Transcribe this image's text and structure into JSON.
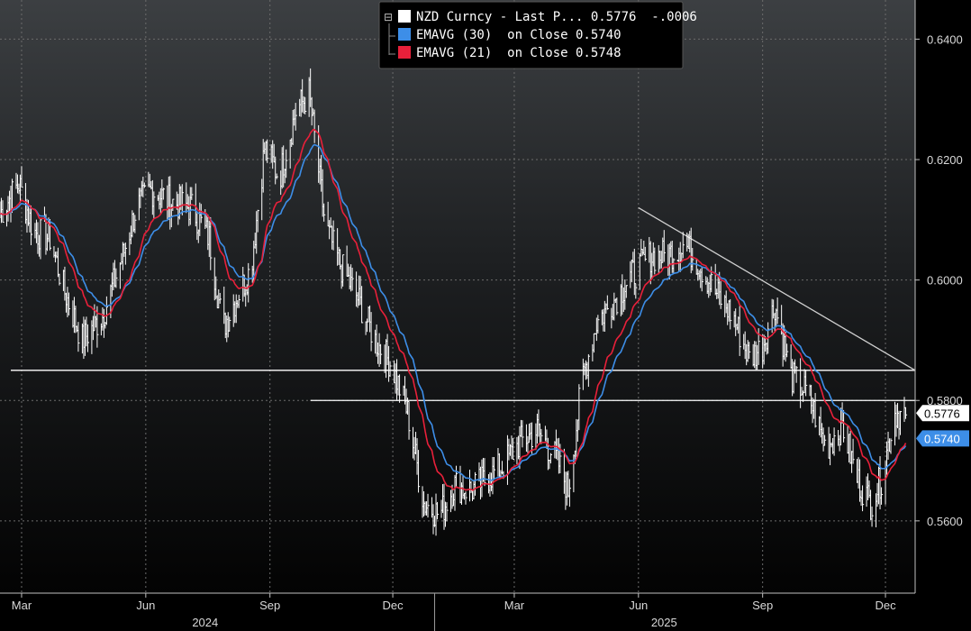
{
  "chart_data": {
    "type": "line",
    "title": "",
    "background": "#000000",
    "ylim": [
      0.548,
      0.6465
    ],
    "y_ticks": [
      "0.6400",
      "0.6200",
      "0.6000",
      "0.5800",
      "0.5600"
    ],
    "y_tick_values": [
      0.64,
      0.62,
      0.6,
      0.58,
      0.56
    ],
    "x_tick_labels": [
      "Mar",
      "Jun",
      "Sep",
      "Dec",
      "Mar",
      "Jun",
      "Sep",
      "Dec"
    ],
    "x_tick_dates": [
      "2024-03-01",
      "2024-06-01",
      "2024-09-01",
      "2024-12-01",
      "2025-03-01",
      "2025-06-01",
      "2025-09-01",
      "2025-12-01"
    ],
    "x_year_labels": [
      {
        "label": "2024",
        "date": "2024-07-15"
      },
      {
        "label": "2025",
        "date": "2025-06-20"
      }
    ],
    "x_range": [
      "2024-02-14",
      "2025-12-23"
    ],
    "legend": {
      "collapse_glyph": "⊟",
      "entries": [
        {
          "label": "NZD Curncy - Last P... 0.5776  -.0006",
          "color": "#ffffff"
        },
        {
          "label": "EMAVG (30)  on Close 0.5740",
          "color": "#3d8ee8"
        },
        {
          "label": "EMAVG (21)  on Close 0.5748",
          "color": "#e8203a"
        }
      ]
    },
    "last_value_tags": [
      {
        "label": "0.5776",
        "value": 0.5776,
        "bg": "#ffffff",
        "fg": "#000000"
      },
      {
        "label": "0.5740",
        "value": 0.574,
        "bg": "#3d8ee8",
        "fg": "#ffffff"
      }
    ],
    "annotations": {
      "horizontal_lines": [
        {
          "y": 0.585,
          "from": "2024-02-22",
          "to": "2025-12-23"
        },
        {
          "y": 0.58,
          "from": "2024-10-01",
          "to": "2025-12-23"
        }
      ],
      "trendline": {
        "from": [
          "2025-06-01",
          0.612
        ],
        "to": [
          "2025-12-23",
          0.585
        ]
      }
    },
    "price_path": [
      [
        "2024-02-14",
        0.611
      ],
      [
        "2024-02-28",
        0.616
      ],
      [
        "2024-03-10",
        0.608
      ],
      [
        "2024-03-22",
        0.607
      ],
      [
        "2024-04-02",
        0.598
      ],
      [
        "2024-04-15",
        0.59
      ],
      [
        "2024-04-30",
        0.594
      ],
      [
        "2024-05-15",
        0.604
      ],
      [
        "2024-05-25",
        0.612
      ],
      [
        "2024-06-05",
        0.615
      ],
      [
        "2024-06-20",
        0.613
      ],
      [
        "2024-07-05",
        0.612
      ],
      [
        "2024-07-18",
        0.607
      ],
      [
        "2024-07-28",
        0.592
      ],
      [
        "2024-08-05",
        0.596
      ],
      [
        "2024-08-18",
        0.602
      ],
      [
        "2024-08-28",
        0.622
      ],
      [
        "2024-09-08",
        0.617
      ],
      [
        "2024-09-20",
        0.628
      ],
      [
        "2024-09-30",
        0.631
      ],
      [
        "2024-10-12",
        0.609
      ],
      [
        "2024-10-24",
        0.602
      ],
      [
        "2024-11-05",
        0.597
      ],
      [
        "2024-11-18",
        0.59
      ],
      [
        "2024-11-30",
        0.586
      ],
      [
        "2024-12-12",
        0.578
      ],
      [
        "2024-12-24",
        0.563
      ],
      [
        "2025-01-05",
        0.561
      ],
      [
        "2025-01-16",
        0.566
      ],
      [
        "2025-01-28",
        0.565
      ],
      [
        "2025-02-08",
        0.567
      ],
      [
        "2025-02-20",
        0.569
      ],
      [
        "2025-03-05",
        0.573
      ],
      [
        "2025-03-18",
        0.575
      ],
      [
        "2025-04-02",
        0.57
      ],
      [
        "2025-04-10",
        0.565
      ],
      [
        "2025-04-20",
        0.583
      ],
      [
        "2025-05-01",
        0.593
      ],
      [
        "2025-05-15",
        0.597
      ],
      [
        "2025-05-28",
        0.601
      ],
      [
        "2025-06-10",
        0.604
      ],
      [
        "2025-06-22",
        0.604
      ],
      [
        "2025-07-05",
        0.606
      ],
      [
        "2025-07-15",
        0.603
      ],
      [
        "2025-07-28",
        0.598
      ],
      [
        "2025-08-10",
        0.594
      ],
      [
        "2025-08-22",
        0.587
      ],
      [
        "2025-09-01",
        0.589
      ],
      [
        "2025-09-10",
        0.596
      ],
      [
        "2025-09-22",
        0.584
      ],
      [
        "2025-10-05",
        0.581
      ],
      [
        "2025-10-18",
        0.572
      ],
      [
        "2025-10-30",
        0.576
      ],
      [
        "2025-11-10",
        0.567
      ],
      [
        "2025-11-20",
        0.563
      ],
      [
        "2025-11-28",
        0.567
      ],
      [
        "2025-12-08",
        0.578
      ],
      [
        "2025-12-16",
        0.5776
      ]
    ]
  }
}
